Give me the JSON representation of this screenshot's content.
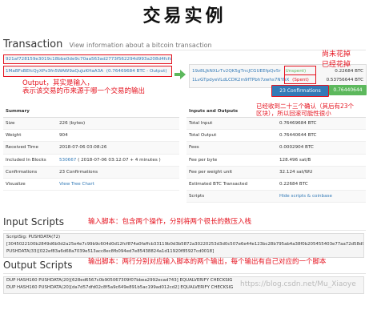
{
  "page_title": "交易实例",
  "header": {
    "title": "Transaction",
    "subtitle": "View information about a bitcoin transaction"
  },
  "tx": {
    "hash": "921af728159e3019c18bbe0de9c70aa563ad2773f562294d993a208d4fcfdd24",
    "input_address": "1MaBFsBEfcQyXPv3fn5WAW9aQuJuKHaA3A",
    "input_amount": "(0.76469684 BTC - Output)",
    "output_arrow_icon": "arrow-right-icon",
    "outputs": [
      {
        "address": "19z8LJkNXLrTv2QK5gTncJCGUEEfpQv5r",
        "status": "(Unspent)",
        "amount": "0.22684 BTC",
        "status_color": "#5cb85c"
      },
      {
        "address": "1LvGTpdyeVLdLCDK2m9fTPbh7zwhs7NYhX",
        "status": "(Spent)",
        "amount": "0.53756644 BTC",
        "status_color": "#e5131f"
      }
    ],
    "confirmations_button": "23 Confirmations",
    "total_button": "0.76440644 BTC"
  },
  "summary": {
    "heading": "Summary",
    "rows": [
      {
        "label": "Size",
        "value": "226 (bytes)"
      },
      {
        "label": "Weight",
        "value": "904"
      },
      {
        "label": "Received Time",
        "value": "2018-07-06 03:08:26"
      },
      {
        "label": "Included In Blocks",
        "value": "530667",
        "value_extra": "( 2018-07-06 03:12:07 + 4 minutes )"
      },
      {
        "label": "Confirmations",
        "value": "23 Confirmations"
      },
      {
        "label": "Visualize",
        "value": "View Tree Chart"
      }
    ]
  },
  "io": {
    "heading": "Inputs and Outputs",
    "rows": [
      {
        "label": "Total Input",
        "value": "0.76469684 BTC"
      },
      {
        "label": "Total Output",
        "value": "0.76440644 BTC"
      },
      {
        "label": "Fees",
        "value": "0.0002904 BTC"
      },
      {
        "label": "Fee per byte",
        "value": "128.496 sat/B"
      },
      {
        "label": "Fee per weight unit",
        "value": "32.124 sat/WU"
      },
      {
        "label": "Estimated BTC Transacted",
        "value": "0.22684 BTC"
      },
      {
        "label": "Scripts",
        "value": "Hide scripts & coinbase"
      }
    ]
  },
  "input_scripts": {
    "title": "Input Scripts",
    "lines": [
      "ScriptSig: PUSHDATA(72)",
      "[3045022100b2849d6b0d2a25e4e7c99b9c604d0d12fcf874a0faffcb33119b0d3b5872a30220253d3d0c507e6e44e123bc28b795ab4a38f0b205455403e77aa72d58d9e17",
      "PUSHDATA(33)[022ef83a6d68a7039e513acc8ec8fb094ed7e85438824a1d11920f85927cd0018]"
    ]
  },
  "output_scripts": {
    "title": "Output Scripts",
    "lines": [
      "DUP HASH160 PUSHDATA(20)[628ed6567c0b905067309f07bbea2992ecad743] EQUALVERIFY CHECKSIG",
      "DUP HASH160 PUSHDATA(20)[da7d57dfd02c8f5a9c649e891b5ac199ad012cd2] EQUALVERIFY CHECKSIG"
    ]
  },
  "annotations": {
    "output_note": "Output，其实是输入，\n表示该交易的币来源于哪一个交易的输出",
    "unspent_note": "尚未花掉",
    "spent_note": "已经花掉",
    "confirm_note": "已经收到二十三个确认（其后有23个\n区块），所以回滚可能性很小",
    "input_script_note": "输入脚本：包含两个操作，分别将两个很长的数压入栈",
    "output_script_note": "输出脚本：两行分别对应输入脚本的两个输出，每个输出有自己对应的一个脚本"
  },
  "watermark": "https://blog.csdn.net/Mu_Xiaoye",
  "colors": {
    "annotation_red": "#e5131f",
    "link_blue": "#337ab7",
    "button_blue": "#337ab7",
    "button_green": "#5cb85c"
  }
}
